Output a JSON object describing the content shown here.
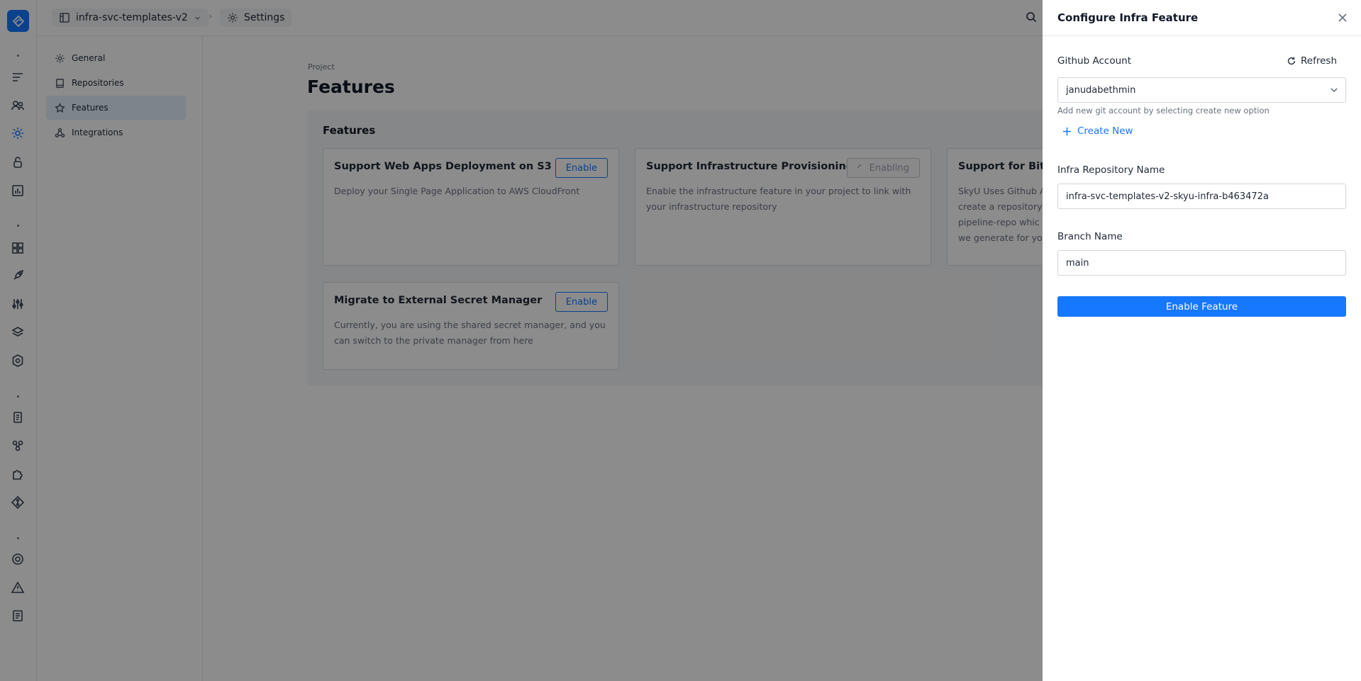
{
  "topbar": {
    "project_name": "infra-svc-templates-v2",
    "settings_label": "Settings",
    "separator": "›"
  },
  "sidebar": {
    "items": [
      {
        "label": "General",
        "icon": "gear-icon"
      },
      {
        "label": "Repositories",
        "icon": "repository-icon"
      },
      {
        "label": "Features",
        "icon": "star-icon",
        "active": true
      },
      {
        "label": "Integrations",
        "icon": "integration-icon"
      }
    ]
  },
  "main": {
    "breadcrumb_label": "Project",
    "title": "Features",
    "panel_title": "Features",
    "cards": [
      {
        "title": "Support Web Apps Deployment on S3",
        "description": "Deploy your Single Page Application to AWS CloudFront",
        "button": "Enable",
        "state": "enabled"
      },
      {
        "title": "Support Infrastructure Provisioning",
        "description": "Enable the infrastructure feature in your project to link with your infrastructure repository",
        "button": "Enabling",
        "state": "loading"
      },
      {
        "title": "Support for Bitbuc",
        "description": "SkyU Uses Github A create a repository pipeline-repo whic we generate for yo",
        "button": "",
        "state": "clipped"
      },
      {
        "title": "Migrate to External Secret Manager",
        "description": "Currently, you are using the shared secret manager, and you can switch to the private manager from here",
        "button": "Enable",
        "state": "enabled"
      }
    ]
  },
  "drawer": {
    "title": "Configure Infra Feature",
    "github_label": "Github Account",
    "refresh_label": "Refresh",
    "github_value": "janudabethmin",
    "hint": "Add new git account by selecting create new option",
    "create_new": "Create New",
    "repo_label": "Infra Repository Name",
    "repo_value": "infra-svc-templates-v2-skyu-infra-b463472a",
    "branch_label": "Branch Name",
    "branch_value": "main",
    "submit_label": "Enable Feature"
  },
  "colors": {
    "accent": "#1677ff",
    "overlay": "rgba(0,0,0,0.45)"
  }
}
